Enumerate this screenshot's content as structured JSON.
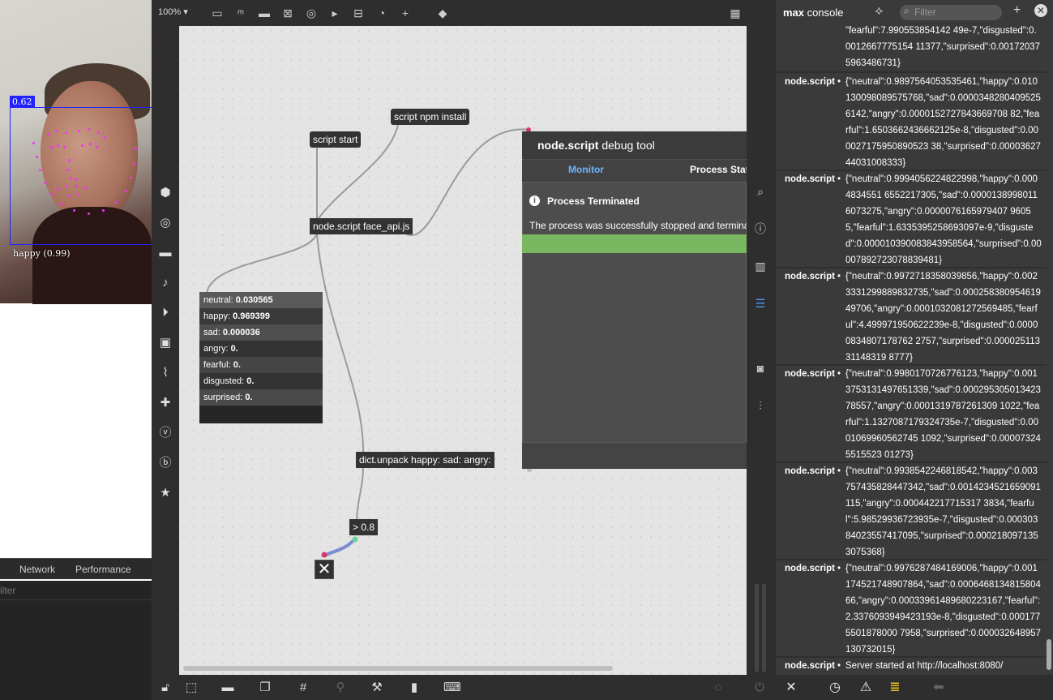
{
  "webcam": {
    "score_tag": "0.62",
    "emotion_label": "happy (0.99)"
  },
  "devtools": {
    "tabs": [
      "Network",
      "Performance"
    ],
    "filter_placeholder": "ilter"
  },
  "patcher": {
    "zoom": "100%",
    "objects": {
      "script_npm": "script npm install",
      "script_start": "script start",
      "node_script": "node.script face_api.js",
      "dict_unpack": "dict.unpack happy: sad: angry:",
      "compare": "> 0.8"
    },
    "dict_view": [
      {
        "key": "neutral:",
        "value": "0.030565"
      },
      {
        "key": "happy:",
        "value": "0.969399"
      },
      {
        "key": "sad:",
        "value": "0.000036"
      },
      {
        "key": "angry:",
        "value": "0."
      },
      {
        "key": "fearful:",
        "value": "0."
      },
      {
        "key": "disgusted:",
        "value": "0."
      },
      {
        "key": "surprised:",
        "value": "0."
      }
    ],
    "toggle_symbol": "✕"
  },
  "debug_tool": {
    "title_bold": "node.script",
    "title_rest": "debug tool",
    "tab_monitor": "Monitor",
    "tab_stats": "Process Stats",
    "status": "Process Terminated",
    "message": "The process was successfully stopped and terminated"
  },
  "console": {
    "title_bold": "max",
    "title_rest": "console",
    "filter_placeholder": "Filter",
    "entries": [
      {
        "source": "",
        "text": "\"fearful\":7.990553854142 49e-7,\"disgusted\":0.0012667775154 11377,\"surprised\":0.001720375963486731}"
      },
      {
        "source": "node.script",
        "text": "{\"neutral\":0.9897564053535461,\"happy\":0.010130098089575768,\"sad\":0.00003482804095256142,\"angry\":0.0000152727843669708 82,\"fearful\":1.6503662436662125e-8,\"disgusted\":0.000027175950890523 38,\"surprised\":0.0000362744031008333}"
      },
      {
        "source": "node.script",
        "text": "{\"neutral\":0.9994056224822998,\"happy\":0.0004834551 6552217305,\"sad\":0.00001389980116073275,\"angry\":0.0000076165979407 96055,\"fearful\":1.6335395258693097e-9,\"disgusted\":0.000010390083843958564,\"surprised\":0.00007892723078839481}"
      },
      {
        "source": "node.script",
        "text": "{\"neutral\":0.9972718358039856,\"happy\":0.0023331299889832735,\"sad\":0.00025838095461949706,\"angry\":0.0001032081272569485,\"fearful\":4.499971950622239e-8,\"disgusted\":0.00000834807178762 2757,\"surprised\":0.00002511331148319 8777}"
      },
      {
        "source": "node.script",
        "text": "{\"neutral\":0.9980170726776123,\"happy\":0.0013753131497651339,\"sad\":0.00029530501342378557,\"angry\":0.0001319787261309 1022,\"fearful\":1.1327087179324735e-7,\"disgusted\":0.0001069960562745 1092,\"surprised\":0.000073245515523 01273}"
      },
      {
        "source": "node.script",
        "text": "{\"neutral\":0.9938542246818542,\"happy\":0.003757435828447342,\"sad\":0.0014234521659091115,\"angry\":0.000442217715317 3834,\"fearful\":5.98529936723935e-7,\"disgusted\":0.00030384023557417095,\"surprised\":0.0002180971353075368}"
      },
      {
        "source": "node.script",
        "text": "{\"neutral\":0.9976287484169006,\"happy\":0.001174521748907864,\"sad\":0.000646813481580466,\"angry\":0.00033961489680223167,\"fearful\":2.3376093949423193e-8,\"disgusted\":0.0001775501878000 7958,\"surprised\":0.000032648957130732015}"
      },
      {
        "source": "node.script",
        "text": "Server started at http://localhost:8080/"
      }
    ]
  }
}
